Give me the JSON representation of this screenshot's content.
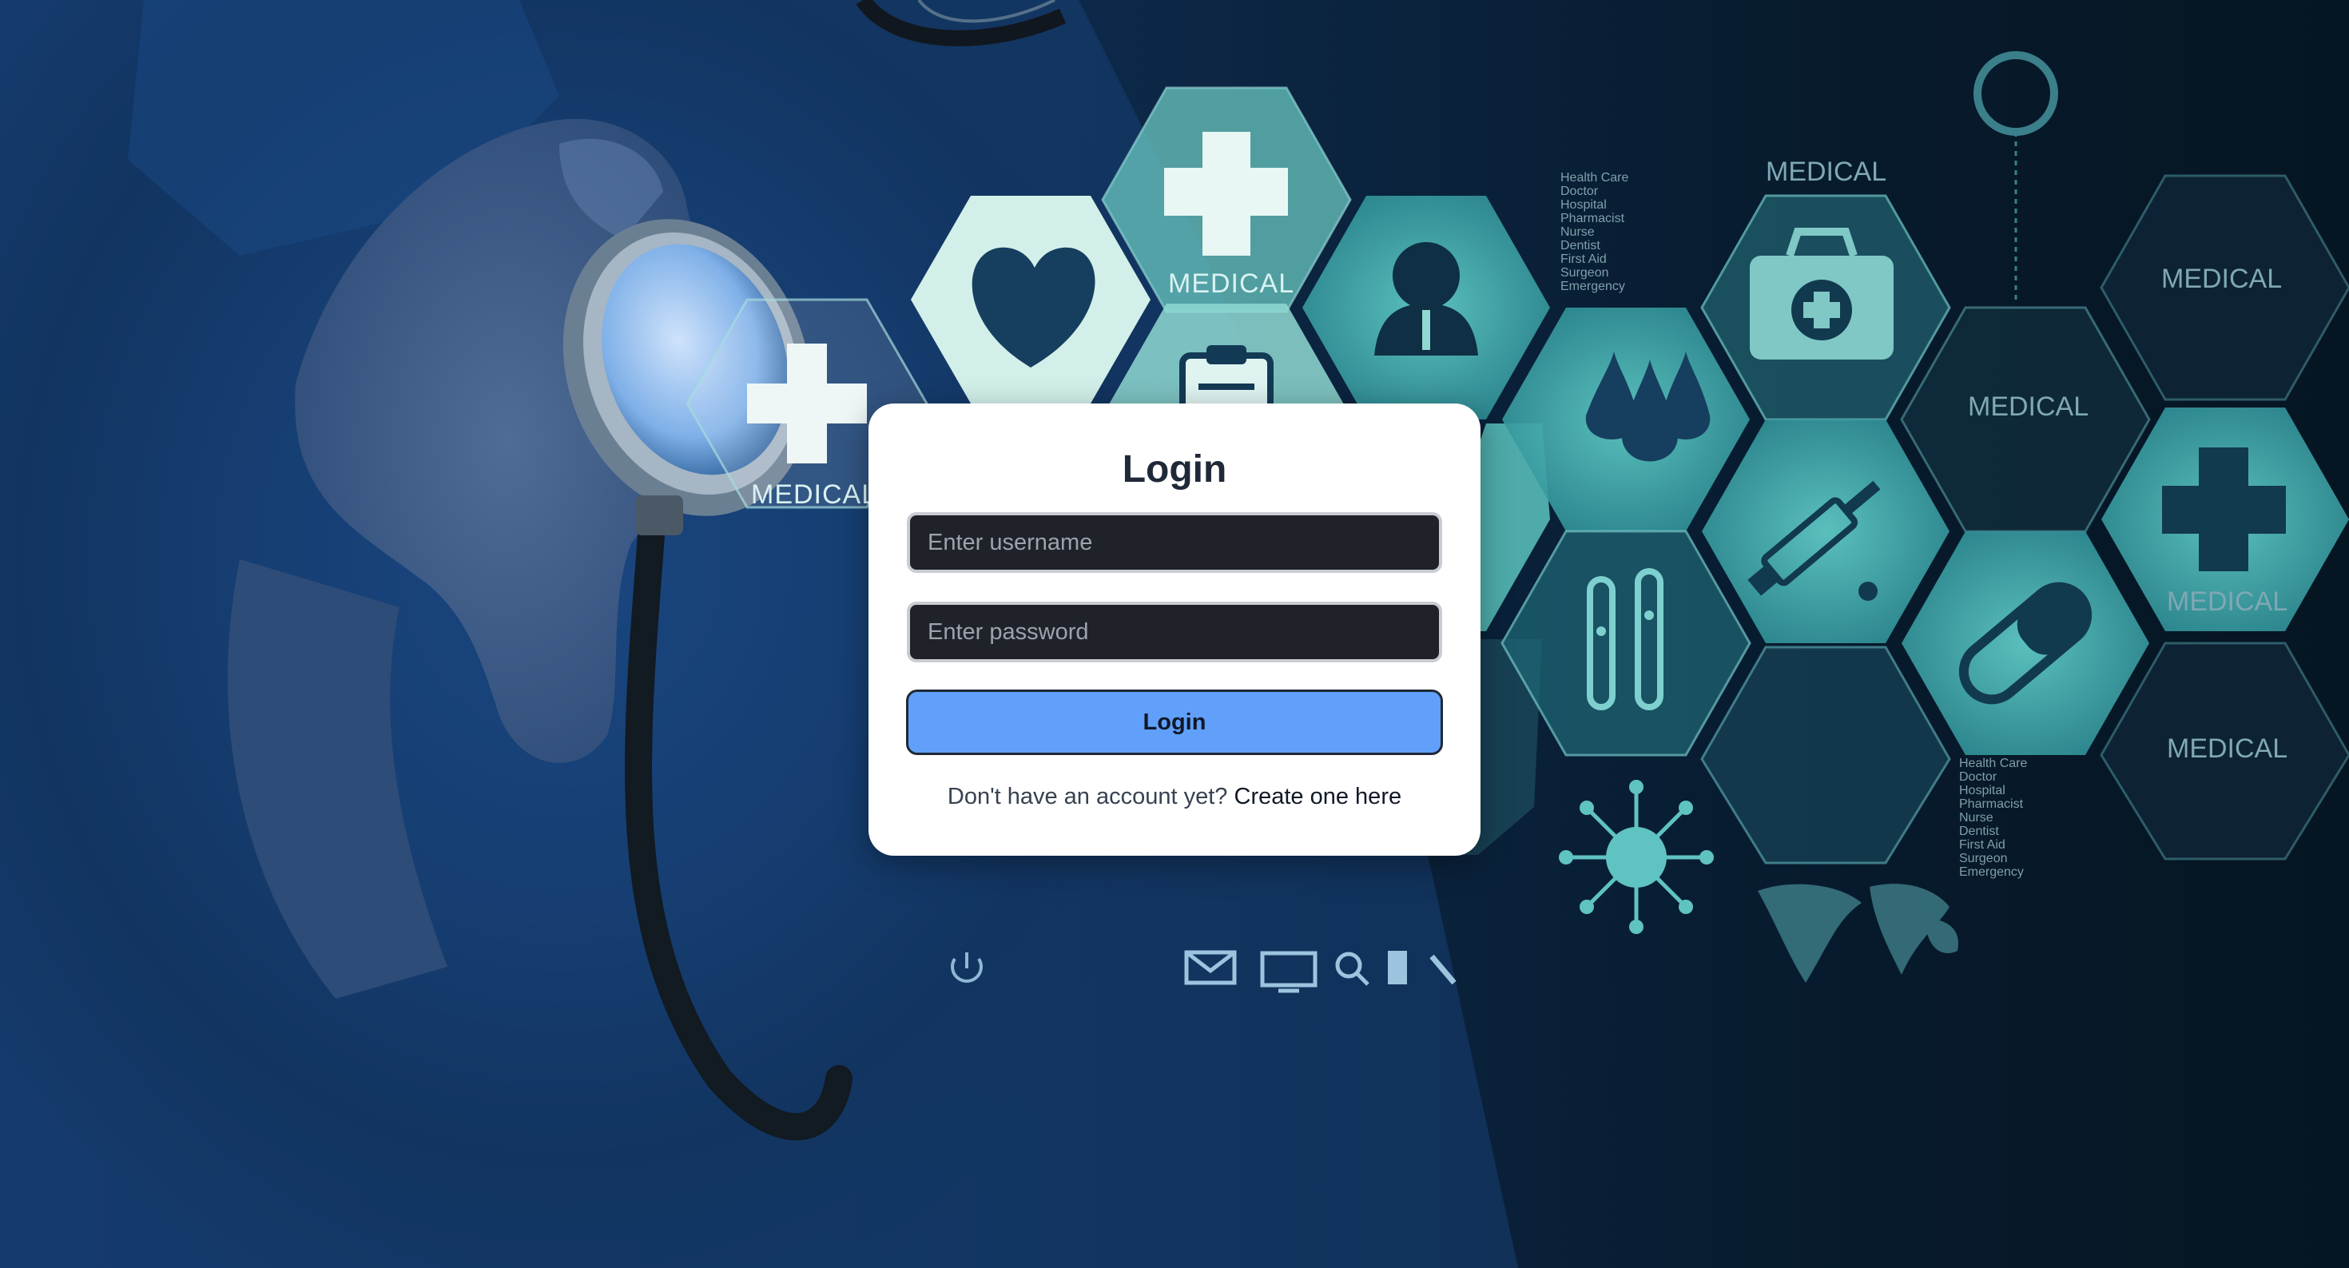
{
  "background": {
    "hex_labels": [
      "MEDICAL",
      "MEDICAL",
      "MEDICAL",
      "MEDICAL",
      "MEDICAL",
      "MEDICAL",
      "MEDICAL"
    ],
    "list_lines": [
      "Health Care",
      "Doctor",
      "Hospital",
      "Pharmacist",
      "Nurse",
      "Dentist",
      "First Aid",
      "Surgeon",
      "Emergency"
    ],
    "icons": [
      "plus-icon",
      "heart-icon",
      "clipboard-icon",
      "person-icon",
      "drops-icon",
      "first-aid-kit-icon",
      "syringe-icon",
      "test-tubes-icon",
      "pill-icon",
      "virus-icon",
      "world-map-icon",
      "power-icon",
      "mail-icon",
      "monitor-icon",
      "search-icon",
      "phone-icon",
      "tool-icon",
      "stethoscope-icon"
    ]
  },
  "login": {
    "title": "Login",
    "username_placeholder": "Enter username",
    "password_placeholder": "Enter password",
    "submit_label": "Login",
    "signup_prompt": "Don't have an account yet?",
    "signup_link": "Create one here"
  },
  "colors": {
    "button_bg": "#60a0fa",
    "field_bg": "#1f2329",
    "card_bg": "#ffffff"
  }
}
